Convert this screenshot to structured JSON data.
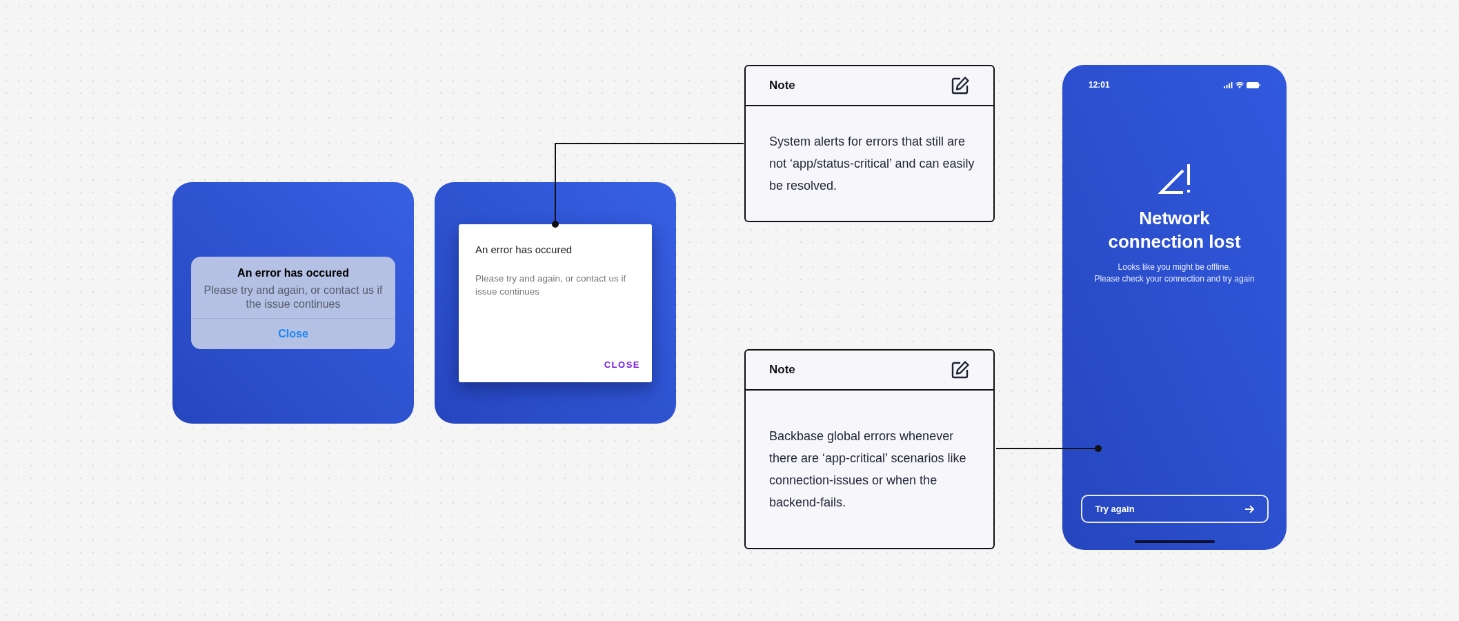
{
  "ios_alert": {
    "title": "An error has occured",
    "message": "Please try and again, or contact us if the issue continues",
    "button": "Close"
  },
  "material_dialog": {
    "title": "An error has occured",
    "message": "Please try and again, or contact us if issue continues",
    "button": "CLOSE"
  },
  "notes": [
    {
      "title": "Note",
      "text": "System alerts for errors that still are not ‘app/status-critical’ and can easily be resolved."
    },
    {
      "title": "Note",
      "text": "Backbase global errors whenever there are ‘app-critical’ scenarios like connection-issues or when the backend-fails."
    }
  ],
  "phone": {
    "time": "12:01",
    "title": "Network connection lost",
    "message_lines": [
      "Looks like you might be offline.",
      "Please check your connection and try again"
    ],
    "button": "Try again"
  }
}
